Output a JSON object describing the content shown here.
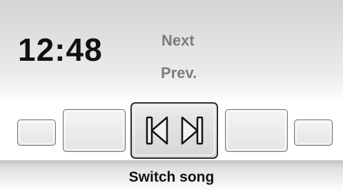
{
  "status": {
    "time": "12:48"
  },
  "menu": {
    "items": [
      {
        "label": "Next"
      },
      {
        "label": "Prev."
      }
    ]
  },
  "carousel": {
    "selected_icons": [
      "skip-previous-icon",
      "skip-next-icon"
    ]
  },
  "footer": {
    "label": "Switch song"
  }
}
